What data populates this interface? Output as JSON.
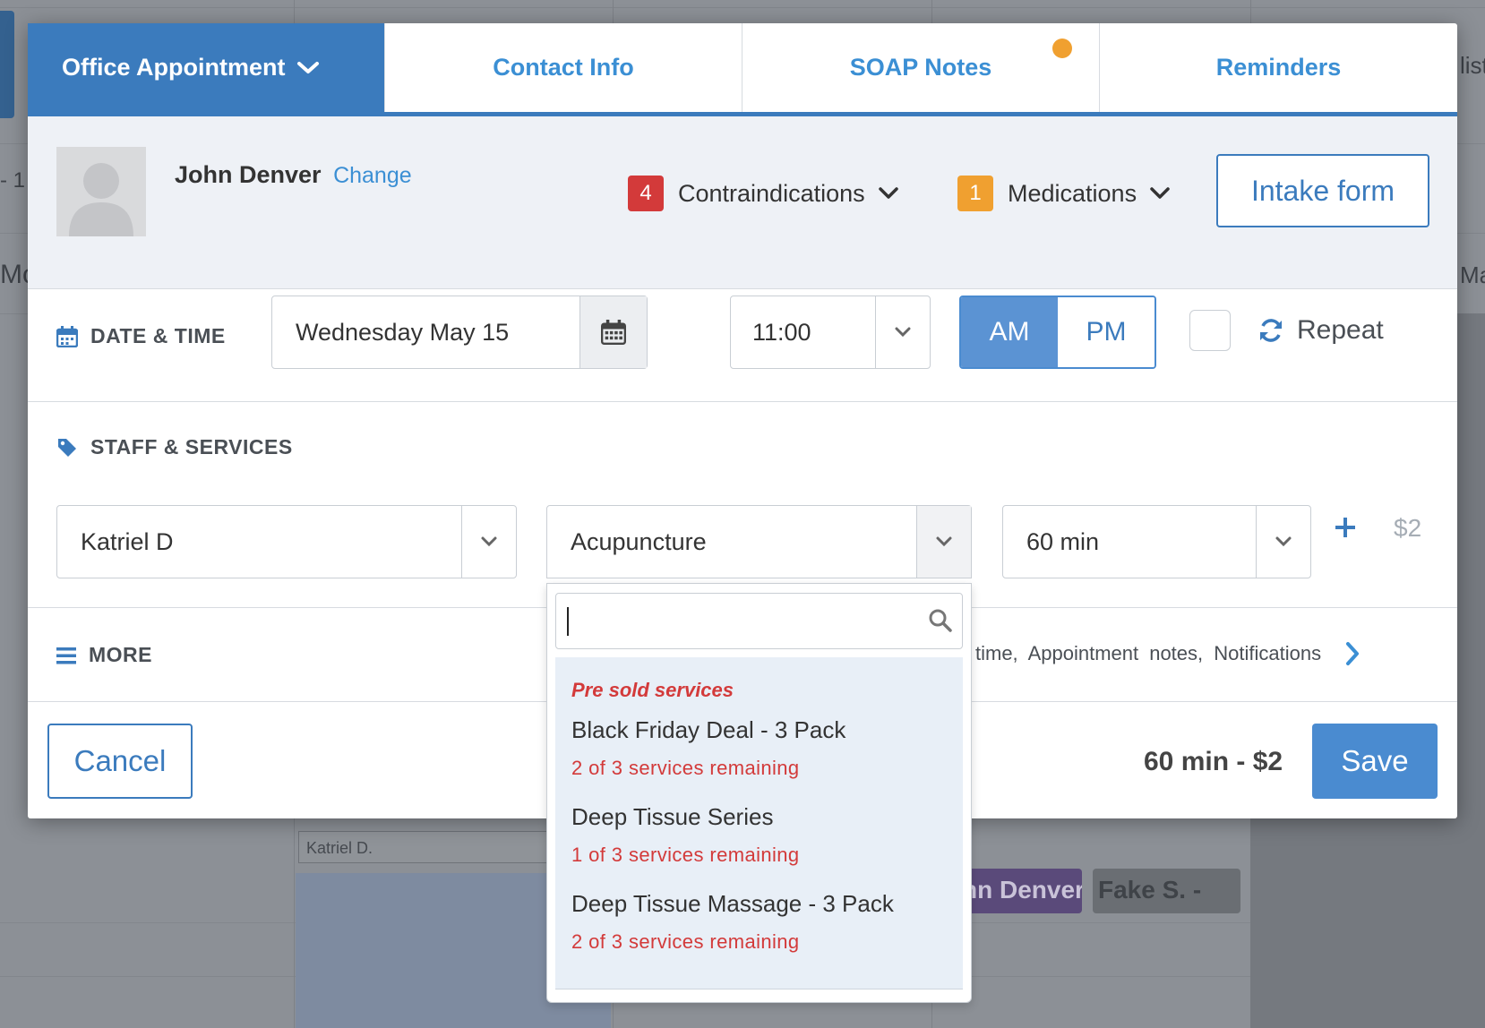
{
  "tabs": {
    "appointment": "Office Appointment",
    "contact": "Contact Info",
    "soap": "SOAP Notes",
    "reminders": "Reminders"
  },
  "client": {
    "name": "John Denver",
    "change_label": "Change",
    "contraindications_count": "4",
    "contraindications_label": "Contraindications",
    "medications_count": "1",
    "medications_label": "Medications",
    "intake_label": "Intake form"
  },
  "datetime": {
    "section_label": "DATE & TIME",
    "date": "Wednesday May 15",
    "time": "11:00",
    "am": "AM",
    "pm": "PM",
    "repeat_label": "Repeat"
  },
  "staff": {
    "section_label": "STAFF & SERVICES",
    "staff_value": "Katriel D",
    "service_value": "Acupuncture",
    "duration_value": "60 min",
    "price_tail": "$2"
  },
  "more": {
    "label": "MORE",
    "items_text": "time, Appointment notes, Notifications"
  },
  "footer": {
    "cancel_label": "Cancel",
    "summary": "60 min - $2",
    "save_label": "Save"
  },
  "dropdown": {
    "search_value": "",
    "group_label": "Pre sold services",
    "items": [
      {
        "title": "Black Friday Deal - 3 Pack",
        "subtitle": "2 of 3 services remaining"
      },
      {
        "title": "Deep Tissue Series",
        "subtitle": "1 of 3 services remaining"
      },
      {
        "title": "Deep Tissue Massage - 3 Pack",
        "subtitle": "2 of 3 services remaining"
      }
    ]
  },
  "background": {
    "staff_name": "Katriel D.",
    "appt_1": "nn Denver",
    "appt_2": "Fake S. -",
    "edge_1": "- 1",
    "edge_2": "Mo",
    "edge_3": "list",
    "edge_4": "Ma"
  },
  "colors": {
    "primary": "#3b7bbd",
    "link": "#3b8fd4",
    "danger": "#d33a3a",
    "warning": "#f0a030"
  }
}
